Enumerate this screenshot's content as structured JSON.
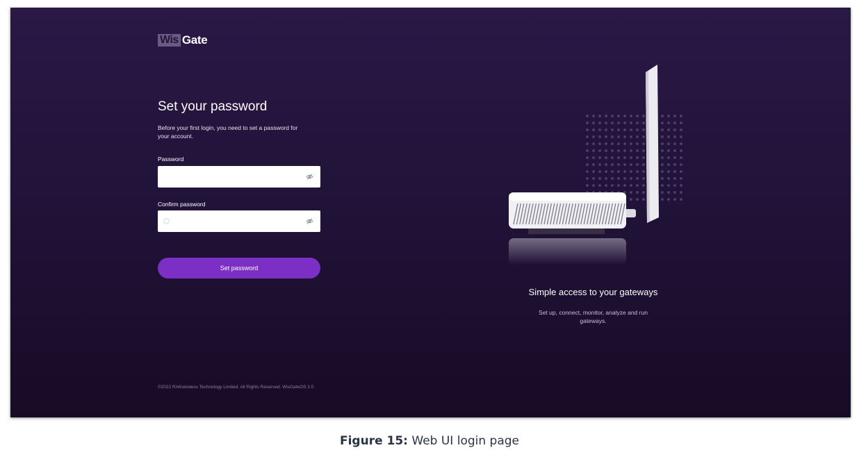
{
  "brand": {
    "logo_part1": "Wis",
    "logo_part2": "Gate"
  },
  "form": {
    "title": "Set your password",
    "subtitle": "Before your first login, you need to set a password for your account.",
    "password_label": "Password",
    "password_placeholder": "",
    "confirm_label": "Confirm password",
    "confirm_placeholder": "",
    "submit_label": "Set password"
  },
  "promo": {
    "title": "Simple access to your gateways",
    "subtitle": "Set up, connect, monitor, analyze and run gateways."
  },
  "footer": {
    "copyright": "©2022 RAKwireless Technology Limited. All Rights Reserved. WisGateOS 2.0"
  },
  "caption": {
    "label": "Figure 15:",
    "text": "Web UI login page"
  },
  "colors": {
    "accent": "#7b2fc4",
    "background": "#211339",
    "logo_block": "#6a5a86"
  },
  "icons": {
    "visibility_toggle": "eye-off-icon",
    "lock": "lock-icon"
  }
}
